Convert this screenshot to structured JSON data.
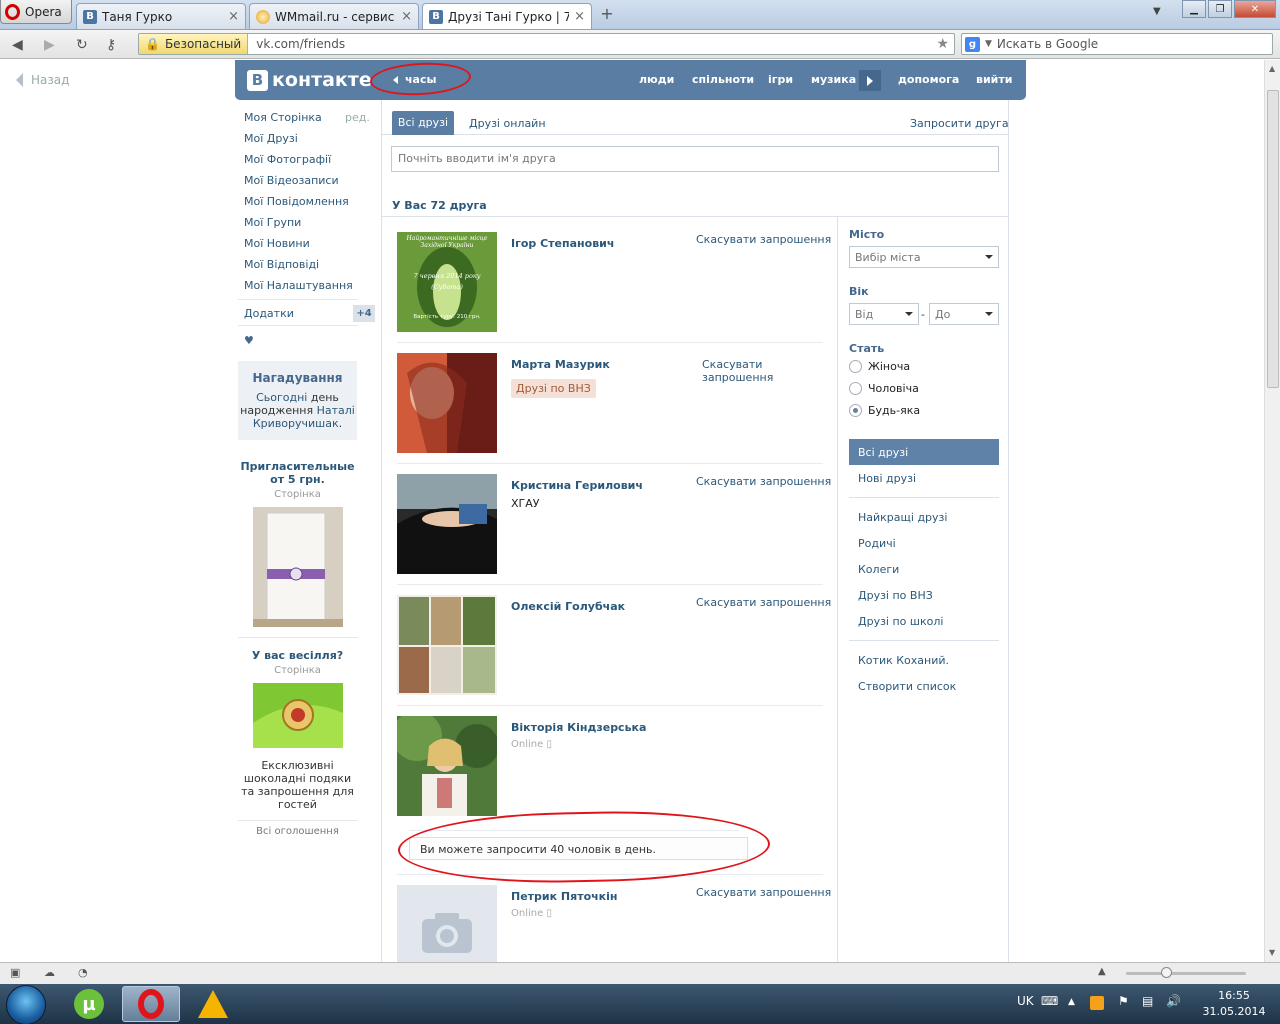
{
  "browser": {
    "menu_label": "Opera",
    "tabs": [
      {
        "title": "Таня Гурко"
      },
      {
        "title": "WMmail.ru - сервис п..."
      },
      {
        "title": "Друзі Тані Гурко | 72 д..."
      }
    ],
    "secure_label": "Безопасный",
    "url": "vk.com/friends",
    "search_placeholder": "Искать в Google",
    "back_label": "Назад"
  },
  "vk": {
    "logo_text": "контакте",
    "logo_letter": "В",
    "player_label": "часы",
    "nav": [
      "люди",
      "спільноти",
      "ігри",
      "музика",
      "допомога",
      "вийти"
    ]
  },
  "left_menu": {
    "items": [
      "Моя Сторінка",
      "Мої Друзі",
      "Мої Фотографії",
      "Мої Відеозаписи",
      "Мої Повідомлення",
      "Мої Групи",
      "Мої Новини",
      "Мої Відповіді",
      "Мої Налаштування"
    ],
    "edit_label": "ред.",
    "addons_label": "Додатки",
    "addons_badge": "+4",
    "heart": "♥",
    "reminder": {
      "title": "Нагадування",
      "line1_link": "Сьогодні",
      "line1_rest": " день",
      "line2": "народження ",
      "line2_link": "Наталі",
      "line3_link": "Криворучишак",
      "line3_rest": "."
    },
    "ads": [
      {
        "title": "Пригласительные от 5 грн.",
        "sub": "Сторінка",
        "desc": ""
      },
      {
        "title": "У вас весілля?",
        "sub": "Сторінка",
        "desc": "Ексклюзивні шоколадні подяки та запрошення для гостей"
      }
    ],
    "all_ads": "Всі оголошення"
  },
  "friends": {
    "tab_all": "Всі друзі",
    "tab_online": "Друзі онлайн",
    "invite": "Запросити друга",
    "search_placeholder": "Почніть вводити ім'я друга",
    "count_text": "У Вас 72 друга",
    "list": [
      {
        "name": "Ігор Степанович",
        "action": "Скасувати запрошення",
        "tag": "",
        "sub": "",
        "online": "",
        "photo_text": [
          "Найромантичніше місце",
          "Західної України",
          "7 червня 2014 року",
          "(Субота)",
          "Вартість туру: 210 грн."
        ]
      },
      {
        "name": "Марта Мазурик",
        "action": "Скасувати запрошення",
        "tag": "Друзі по ВНЗ",
        "sub": "",
        "online": "",
        "photo_text": []
      },
      {
        "name": "Кристина Герилович",
        "action": "Скасувати запрошення",
        "tag": "",
        "sub": "ХГАУ",
        "online": "",
        "photo_text": []
      },
      {
        "name": "Олексій Голубчак",
        "action": "Скасувати запрошення",
        "tag": "",
        "sub": "",
        "online": "",
        "photo_text": []
      },
      {
        "name": "Вікторія Кіндзерська",
        "action": "",
        "tag": "",
        "sub": "",
        "online": "Online",
        "photo_text": []
      },
      {
        "name": "Петрик Пяточкін",
        "action": "Скасувати запрошення",
        "tag": "",
        "sub": "",
        "online": "Online",
        "photo_text": []
      }
    ],
    "limit_message": "Ви можете запросити 40 чоловік в день."
  },
  "filters": {
    "city_label": "Місто",
    "city_select": "Вибір міста",
    "age_label": "Вік",
    "age_from": "Від",
    "age_dash": "-",
    "age_to": "До",
    "sex_label": "Стать",
    "sex_options": [
      "Жіноча",
      "Чоловіча",
      "Будь-яка"
    ],
    "sex_selected": "Будь-яка",
    "lists_active": "Всі друзі",
    "lists": [
      "Нові друзі",
      "Найкращі друзі",
      "Родичі",
      "Колеги",
      "Друзі по ВНЗ",
      "Друзі по школі",
      "Котик Коханий.",
      "Створити список"
    ]
  },
  "taskbar": {
    "lang": "UK",
    "time": "16:55",
    "date": "31.05.2014"
  },
  "colors": {
    "vk_header": "#597da3",
    "link": "#2b587a",
    "annotation": "#e0151c"
  }
}
